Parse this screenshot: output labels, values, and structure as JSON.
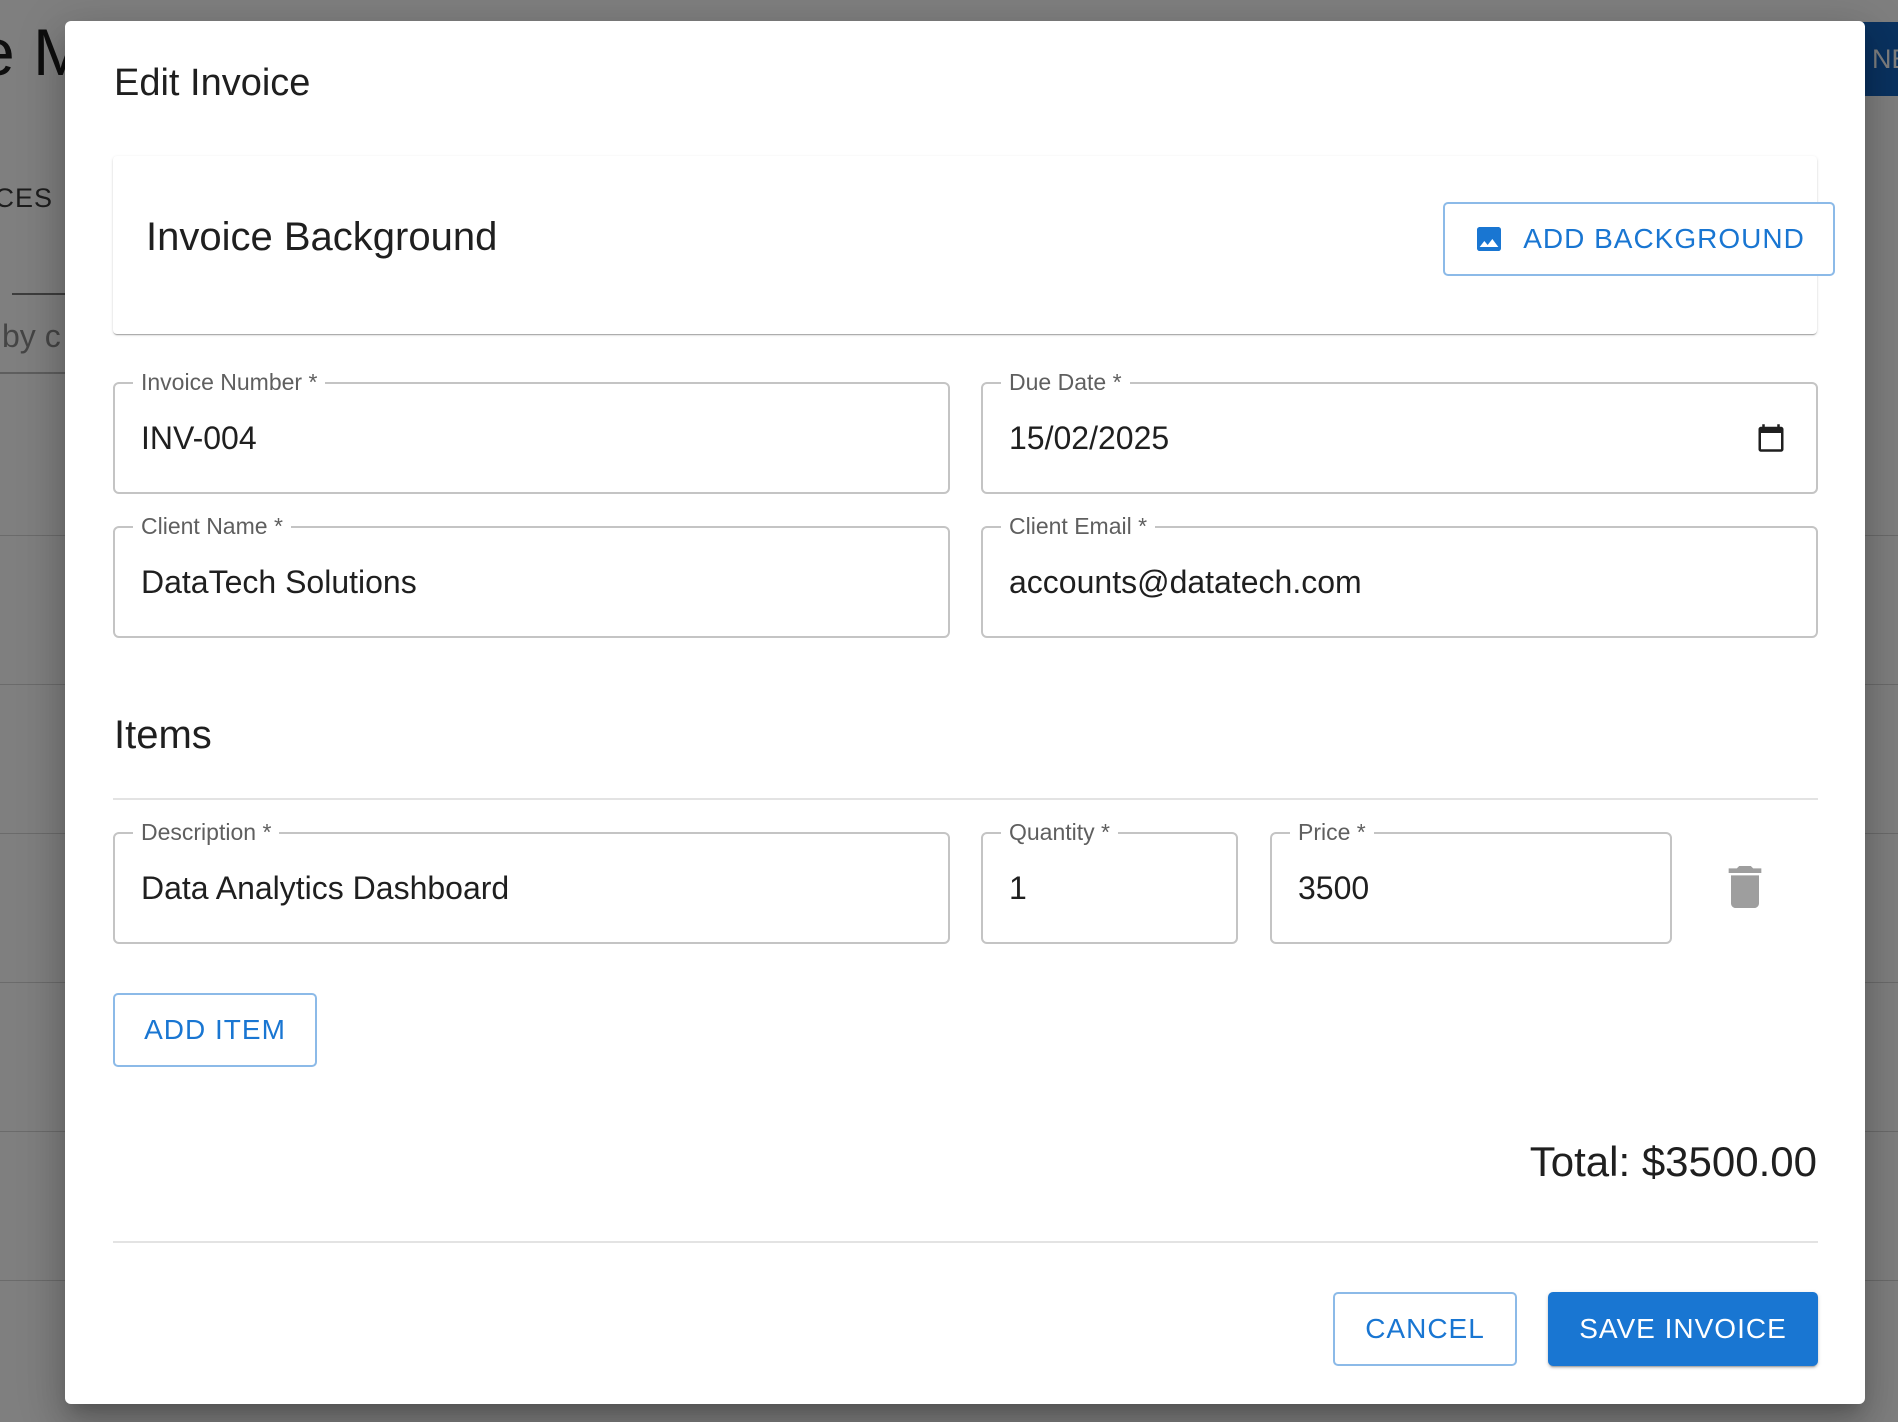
{
  "background_page": {
    "title_fragment": "e M",
    "tab_fragment": "ICES",
    "search_fragment": "by c",
    "new_button_fragment": "NE"
  },
  "dialog": {
    "title": "Edit Invoice",
    "background_card": {
      "title": "Invoice Background",
      "add_button_label": "ADD BACKGROUND",
      "add_button_icon": "image-icon"
    },
    "fields": {
      "invoice_number": {
        "label": "Invoice Number",
        "required_mark": "*",
        "value": "INV-004"
      },
      "due_date": {
        "label": "Due Date",
        "required_mark": "*",
        "value": "15/02/2025",
        "icon": "calendar-icon"
      },
      "client_name": {
        "label": "Client Name",
        "required_mark": "*",
        "value": "DataTech Solutions"
      },
      "client_email": {
        "label": "Client Email",
        "required_mark": "*",
        "value": "accounts@datatech.com"
      }
    },
    "items_section": {
      "title": "Items",
      "items": [
        {
          "description": {
            "label": "Description",
            "required_mark": "*",
            "value": "Data Analytics Dashboard"
          },
          "quantity": {
            "label": "Quantity",
            "required_mark": "*",
            "value": "1"
          },
          "price": {
            "label": "Price",
            "required_mark": "*",
            "value": "3500"
          },
          "delete_icon": "trash-icon"
        }
      ],
      "add_item_label": "ADD ITEM"
    },
    "total": "Total: $3500.00",
    "actions": {
      "cancel_label": "CANCEL",
      "save_label": "SAVE INVOICE"
    }
  },
  "colors": {
    "primary": "#1976d2",
    "field_border": "#c4c4c4",
    "label_text": "#5f5f5f",
    "backdrop": "rgba(0,0,0,0.5)"
  }
}
